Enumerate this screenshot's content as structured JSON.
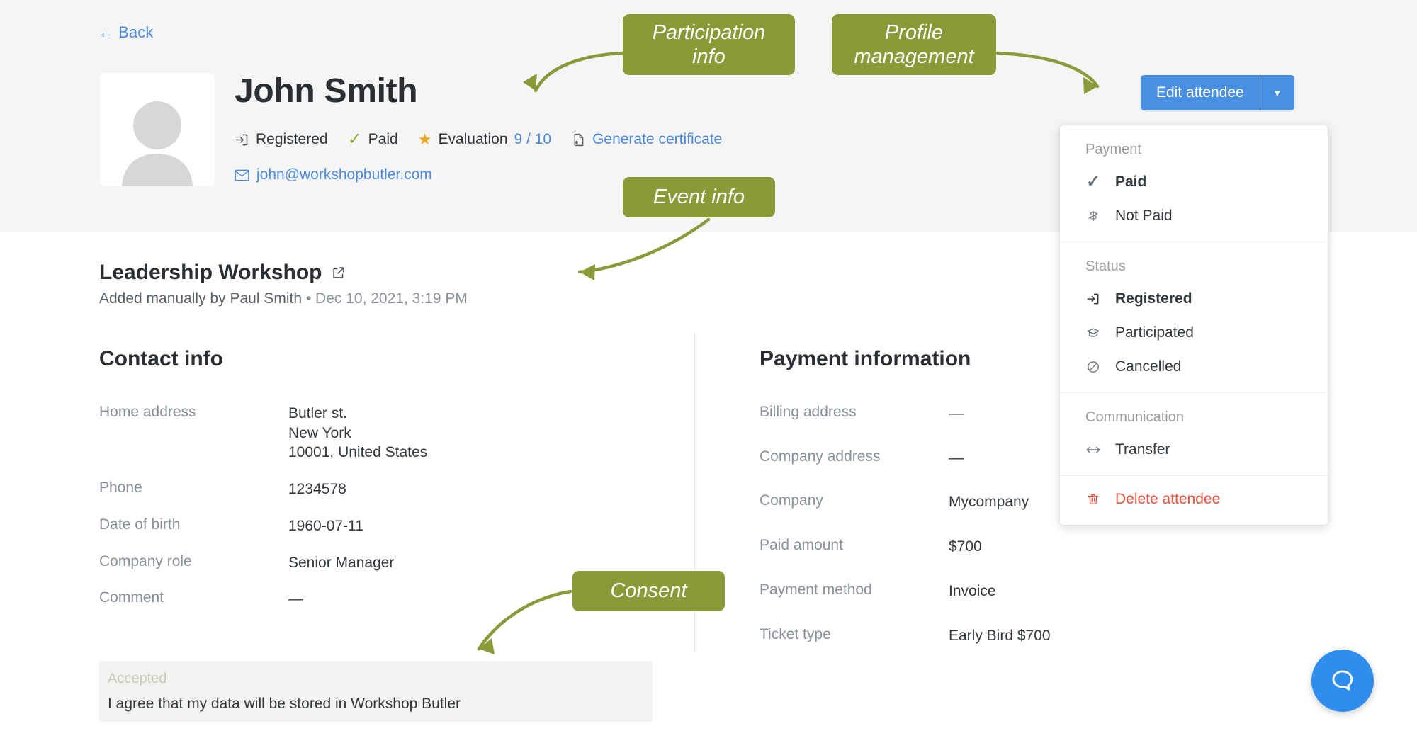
{
  "header": {
    "back_label": "Back",
    "back_icon": "arrow-left-icon",
    "person_name": "John Smith",
    "avatar_icon": "user-avatar-placeholder-icon",
    "status_items": [
      {
        "icon": "login-arrow-icon",
        "label": "Registered"
      },
      {
        "icon": "check-icon",
        "label": "Paid"
      },
      {
        "icon": "star-icon",
        "label": "Evaluation",
        "value": "9 / 10"
      },
      {
        "icon": "certificate-icon",
        "label": "Generate certificate"
      }
    ],
    "email": "john@workshopbutler.com",
    "email_icon": "envelope-icon"
  },
  "actions": {
    "edit_label": "Edit attendee",
    "caret_icon": "chevron-down-icon"
  },
  "dropdown": {
    "sections": [
      {
        "title": "Payment",
        "items": [
          {
            "icon": "check-icon",
            "label": "Paid",
            "selected": true
          },
          {
            "icon": "money-strike-icon",
            "label": "Not Paid",
            "selected": false
          }
        ]
      },
      {
        "title": "Status",
        "items": [
          {
            "icon": "login-arrow-icon",
            "label": "Registered",
            "selected": true
          },
          {
            "icon": "graduation-cap-icon",
            "label": "Participated",
            "selected": false
          },
          {
            "icon": "ban-icon",
            "label": "Cancelled",
            "selected": false
          }
        ]
      },
      {
        "title": "Communication",
        "items": [
          {
            "icon": "transfer-arrows-icon",
            "label": "Transfer",
            "selected": false
          }
        ]
      },
      {
        "title": "",
        "items": [
          {
            "icon": "trash-icon",
            "label": "Delete attendee",
            "selected": false,
            "danger": true
          }
        ]
      }
    ]
  },
  "event": {
    "title": "Leadership Workshop",
    "external_link_icon": "external-link-icon",
    "added_by": "Added manually by Paul Smith",
    "separator": "•",
    "added_on": "Dec 10, 2021, 3:19 PM"
  },
  "contact": {
    "title": "Contact info",
    "fields": [
      {
        "label": "Home address",
        "value": "Butler st.\nNew York\n10001, United States"
      },
      {
        "label": "Phone",
        "value": "1234578"
      },
      {
        "label": "Date of birth",
        "value": "1960-07-11"
      },
      {
        "label": "Company role",
        "value": "Senior Manager"
      },
      {
        "label": "Comment",
        "value": "—"
      }
    ]
  },
  "payment": {
    "title": "Payment information",
    "fields": [
      {
        "label": "Billing address",
        "value": "—"
      },
      {
        "label": "Company address",
        "value": "—"
      },
      {
        "label": "Company",
        "value": "Mycompany"
      },
      {
        "label": "Paid amount",
        "value": "$700"
      },
      {
        "label": "Payment method",
        "value": "Invoice"
      },
      {
        "label": "Ticket type",
        "value": "Early Bird $700"
      }
    ]
  },
  "consent": {
    "status": "Accepted",
    "text": "I agree that my data will be stored in Workshop Butler"
  },
  "annotations": [
    {
      "text": "Participation info",
      "line1": "Participation",
      "line2": "info"
    },
    {
      "text": "Profile management",
      "line1": "Profile",
      "line2": "management"
    },
    {
      "text": "Event info",
      "line1": "Event info",
      "line2": ""
    },
    {
      "text": "Consent",
      "line1": "Consent",
      "line2": ""
    }
  ],
  "chat": {
    "icon": "chat-bubble-icon"
  },
  "colors": {
    "annotation_green": "#8a9a38",
    "primary_blue": "#4a90e2",
    "link_blue": "#4a89dc",
    "danger_red": "#e8523f",
    "check_green": "#8aa832",
    "star_gold": "#f0a91e",
    "header_bg": "#f5f5f5",
    "consent_bg": "#f2f2f0"
  }
}
